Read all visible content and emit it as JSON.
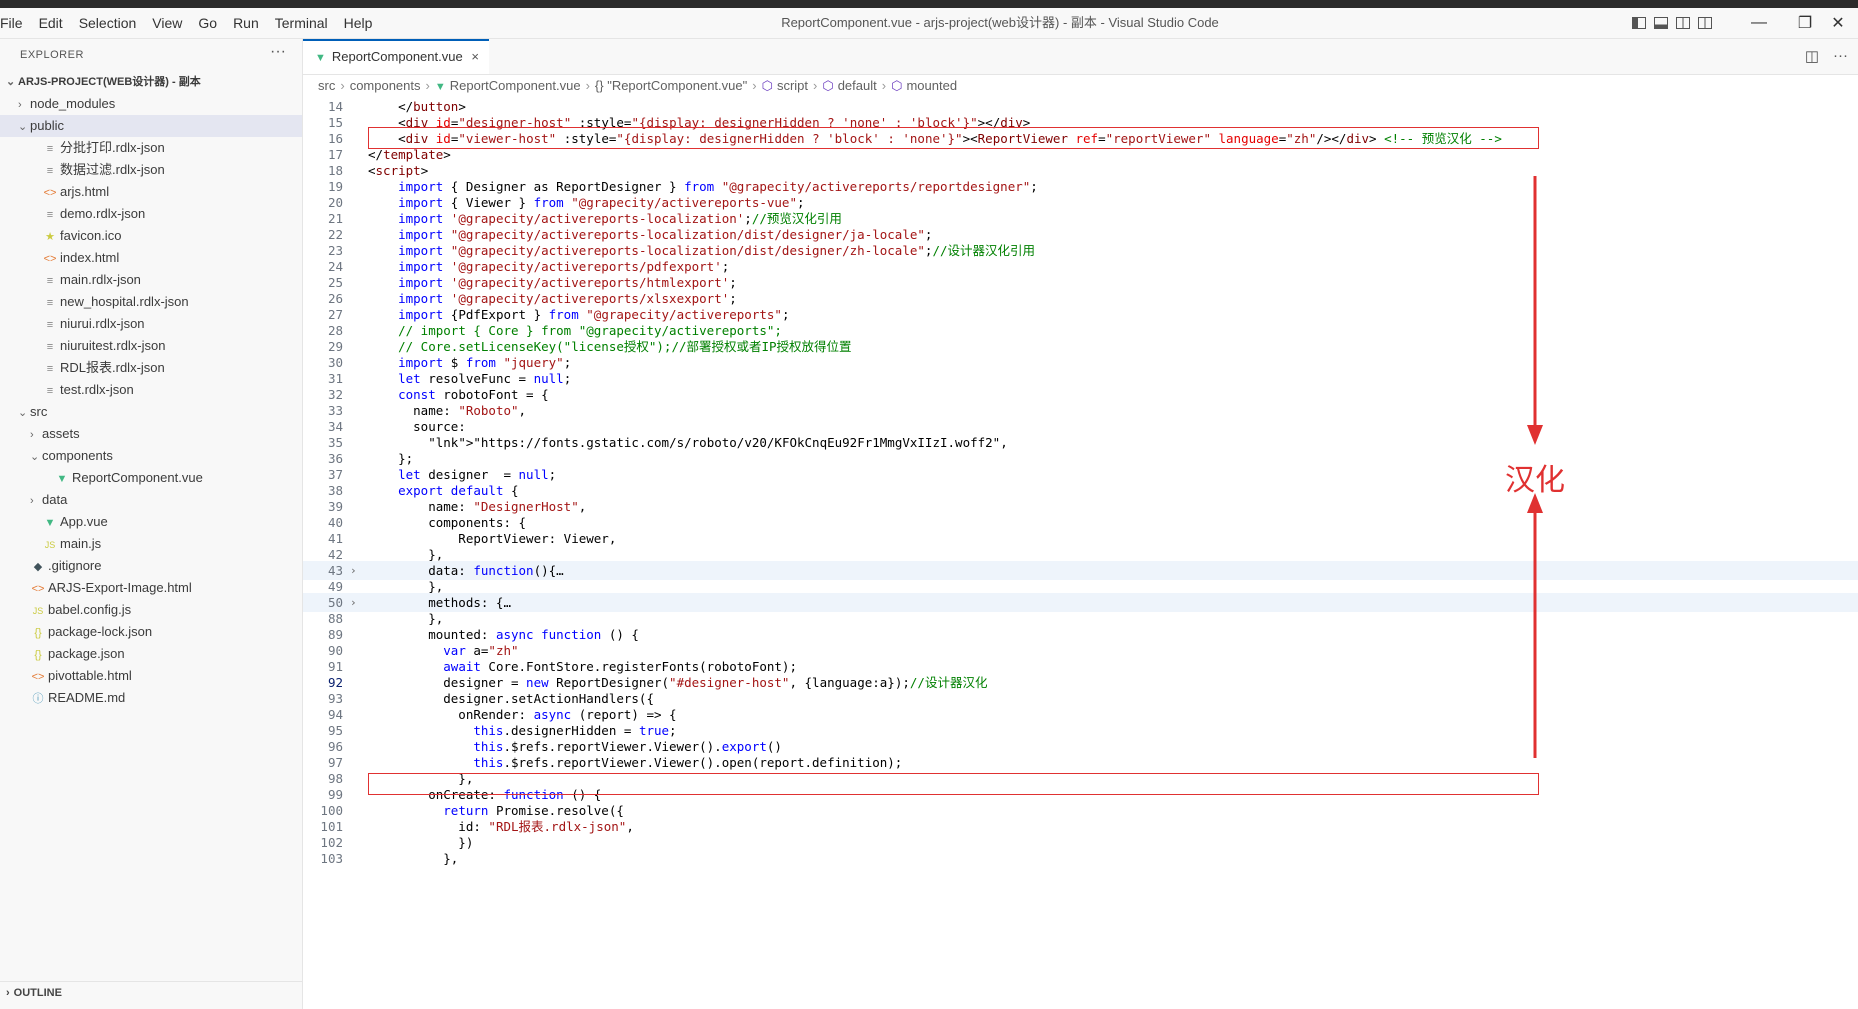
{
  "menu": [
    "File",
    "Edit",
    "Selection",
    "View",
    "Go",
    "Run",
    "Terminal",
    "Help"
  ],
  "window_title": "ReportComponent.vue - arjs-project(web设计器) - 副本 - Visual Studio Code",
  "explorer": {
    "title": "EXPLORER",
    "more": "···",
    "project": "ARJS-PROJECT(WEB设计器) - 副本",
    "items": [
      {
        "label": "node_modules",
        "depth": 1,
        "chev": "›",
        "icon": ""
      },
      {
        "label": "public",
        "depth": 1,
        "chev": "⌄",
        "icon": ""
      },
      {
        "label": "分批打印.rdlx-json",
        "depth": 2,
        "chev": "",
        "icon": "≡"
      },
      {
        "label": "数据过滤.rdlx-json",
        "depth": 2,
        "chev": "",
        "icon": "≡"
      },
      {
        "label": "arjs.html",
        "depth": 2,
        "chev": "",
        "icon": "<>"
      },
      {
        "label": "demo.rdlx-json",
        "depth": 2,
        "chev": "",
        "icon": "≡"
      },
      {
        "label": "favicon.ico",
        "depth": 2,
        "chev": "",
        "icon": "★"
      },
      {
        "label": "index.html",
        "depth": 2,
        "chev": "",
        "icon": "<>"
      },
      {
        "label": "main.rdlx-json",
        "depth": 2,
        "chev": "",
        "icon": "≡"
      },
      {
        "label": "new_hospital.rdlx-json",
        "depth": 2,
        "chev": "",
        "icon": "≡"
      },
      {
        "label": "niurui.rdlx-json",
        "depth": 2,
        "chev": "",
        "icon": "≡"
      },
      {
        "label": "niuruitest.rdlx-json",
        "depth": 2,
        "chev": "",
        "icon": "≡"
      },
      {
        "label": "RDL报表.rdlx-json",
        "depth": 2,
        "chev": "",
        "icon": "≡"
      },
      {
        "label": "test.rdlx-json",
        "depth": 2,
        "chev": "",
        "icon": "≡"
      },
      {
        "label": "src",
        "depth": 1,
        "chev": "⌄",
        "icon": ""
      },
      {
        "label": "assets",
        "depth": 2,
        "chev": "›",
        "icon": ""
      },
      {
        "label": "components",
        "depth": 2,
        "chev": "⌄",
        "icon": ""
      },
      {
        "label": "ReportComponent.vue",
        "depth": 3,
        "chev": "",
        "icon": "▼"
      },
      {
        "label": "data",
        "depth": 2,
        "chev": "›",
        "icon": ""
      },
      {
        "label": "App.vue",
        "depth": 2,
        "chev": "",
        "icon": "▼"
      },
      {
        "label": "main.js",
        "depth": 2,
        "chev": "",
        "icon": "JS"
      },
      {
        "label": ".gitignore",
        "depth": 1,
        "chev": "",
        "icon": "◆"
      },
      {
        "label": "ARJS-Export-Image.html",
        "depth": 1,
        "chev": "",
        "icon": "<>"
      },
      {
        "label": "babel.config.js",
        "depth": 1,
        "chev": "",
        "icon": "JS"
      },
      {
        "label": "package-lock.json",
        "depth": 1,
        "chev": "",
        "icon": "{}"
      },
      {
        "label": "package.json",
        "depth": 1,
        "chev": "",
        "icon": "{}"
      },
      {
        "label": "pivottable.html",
        "depth": 1,
        "chev": "",
        "icon": "<>"
      },
      {
        "label": "README.md",
        "depth": 1,
        "chev": "",
        "icon": "ⓘ"
      }
    ],
    "outline": "OUTLINE"
  },
  "tab": {
    "label": "ReportComponent.vue",
    "close": "×"
  },
  "breadcrumb": [
    "src",
    "components",
    "ReportComponent.vue",
    "{} \"ReportComponent.vue\"",
    "script",
    "default",
    "mounted"
  ],
  "code_lines": [
    {
      "n": "14",
      "text": "    </button>"
    },
    {
      "n": "15",
      "text": "    <div id=\"designer-host\" :style=\"{display: designerHidden ? 'none' : 'block'}\"></div>"
    },
    {
      "n": "16",
      "text": "    <div id=\"viewer-host\" :style=\"{display: designerHidden ? 'block' : 'none'}\"><ReportViewer ref=\"reportViewer\" language=\"zh\"/></div> <!-- 预览汉化 -->"
    },
    {
      "n": "17",
      "text": "</template>"
    },
    {
      "n": "18",
      "text": "<script>"
    },
    {
      "n": "19",
      "text": "    import { Designer as ReportDesigner } from \"@grapecity/activereports/reportdesigner\";"
    },
    {
      "n": "20",
      "text": "    import { Viewer } from \"@grapecity/activereports-vue\";"
    },
    {
      "n": "21",
      "text": "    import '@grapecity/activereports-localization';//预览汉化引用"
    },
    {
      "n": "22",
      "text": "    import \"@grapecity/activereports-localization/dist/designer/ja-locale\";"
    },
    {
      "n": "23",
      "text": "    import \"@grapecity/activereports-localization/dist/designer/zh-locale\";//设计器汉化引用"
    },
    {
      "n": "24",
      "text": "    import '@grapecity/activereports/pdfexport';"
    },
    {
      "n": "25",
      "text": "    import '@grapecity/activereports/htmlexport';"
    },
    {
      "n": "26",
      "text": "    import '@grapecity/activereports/xlsxexport';"
    },
    {
      "n": "27",
      "text": "    import {PdfExport } from \"@grapecity/activereports\";"
    },
    {
      "n": "28",
      "text": "    // import { Core } from \"@grapecity/activereports\";"
    },
    {
      "n": "29",
      "text": "    // Core.setLicenseKey(\"license授权\");//部署授权或者IP授权放得位置"
    },
    {
      "n": "30",
      "text": "    import $ from \"jquery\";"
    },
    {
      "n": "31",
      "text": "    let resolveFunc = null;"
    },
    {
      "n": "32",
      "text": "    const robotoFont = {"
    },
    {
      "n": "33",
      "text": "      name: \"Roboto\","
    },
    {
      "n": "34",
      "text": "      source:"
    },
    {
      "n": "35",
      "text": "        \"https://fonts.gstatic.com/s/roboto/v20/KFOkCnqEu92Fr1MmgVxIIzI.woff2\","
    },
    {
      "n": "36",
      "text": "    };"
    },
    {
      "n": "37",
      "text": "    let designer  = null;"
    },
    {
      "n": "38",
      "text": "    export default {"
    },
    {
      "n": "39",
      "text": "        name: \"DesignerHost\","
    },
    {
      "n": "40",
      "text": "        components: {"
    },
    {
      "n": "41",
      "text": "            ReportViewer: Viewer,"
    },
    {
      "n": "42",
      "text": "        },"
    },
    {
      "n": "43",
      "text": "        data: function(){…"
    },
    {
      "n": "49",
      "text": "        },"
    },
    {
      "n": "50",
      "text": "        methods: {…"
    },
    {
      "n": "88",
      "text": "        },"
    },
    {
      "n": "89",
      "text": "        mounted: async function () {"
    },
    {
      "n": "90",
      "text": "          var a=\"zh\""
    },
    {
      "n": "91",
      "text": "          await Core.FontStore.registerFonts(robotoFont);"
    },
    {
      "n": "92",
      "text": "          designer = new ReportDesigner(\"#designer-host\", {language:a});//设计器汉化"
    },
    {
      "n": "93",
      "text": "          designer.setActionHandlers({"
    },
    {
      "n": "94",
      "text": "            onRender: async (report) => {"
    },
    {
      "n": "95",
      "text": "              this.designerHidden = true;"
    },
    {
      "n": "96",
      "text": "              this.$refs.reportViewer.Viewer().export()"
    },
    {
      "n": "97",
      "text": "              this.$refs.reportViewer.Viewer().open(report.definition);"
    },
    {
      "n": "98",
      "text": "            },"
    },
    {
      "n": "99",
      "text": "        onCreate: function () {"
    },
    {
      "n": "100",
      "text": "          return Promise.resolve({"
    },
    {
      "n": "101",
      "text": "            id: \"RDL报表.rdlx-json\","
    },
    {
      "n": "102",
      "text": "            })"
    },
    {
      "n": "103",
      "text": "          },"
    }
  ],
  "annotation": "汉化",
  "colors": {
    "annotation": "#e03131",
    "accent": "#005fb8",
    "vue": "#41b883"
  }
}
